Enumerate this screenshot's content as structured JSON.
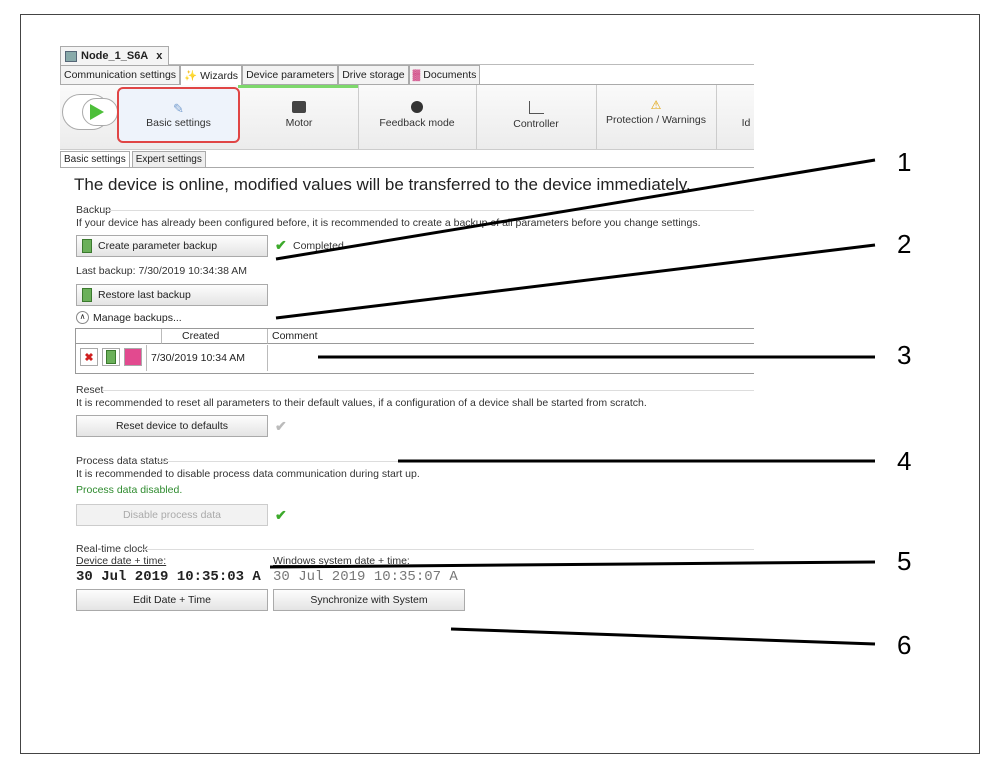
{
  "document_tab": {
    "title": "Node_1_S6A",
    "close": "x"
  },
  "section_tabs": [
    {
      "label": "Communication settings"
    },
    {
      "label": "Wizards",
      "active": true
    },
    {
      "label": "Device parameters"
    },
    {
      "label": "Drive storage"
    },
    {
      "label": "Documents"
    }
  ],
  "wizard_steps": [
    {
      "label": "Basic settings",
      "icon": "pen-icon",
      "active": true
    },
    {
      "label": "Motor",
      "icon": "motor-icon"
    },
    {
      "label": "Feedback mode",
      "icon": "feedback-icon"
    },
    {
      "label": "Controller",
      "icon": "controller-icon"
    },
    {
      "label": "Protection / Warnings",
      "icon": "warning-icon"
    },
    {
      "label": "Id"
    }
  ],
  "sub_tabs": [
    {
      "label": "Basic settings",
      "active": true
    },
    {
      "label": "Expert settings"
    }
  ],
  "headline": "The device is online, modified  values will be transferred to the device immediately.",
  "backup": {
    "title": "Backup",
    "description": "If your device has already been configured before, it is recommended to create a backup of all parameters before you change settings.",
    "create_button": "Create parameter backup",
    "status": "Completed",
    "last_backup": "Last backup:  7/30/2019 10:34:38 AM",
    "restore_button": "Restore last backup",
    "manage": "Manage backups...",
    "table": {
      "columns": [
        "Created",
        "Comment"
      ],
      "rows": [
        {
          "created": "7/30/2019 10:34 AM",
          "comment": ""
        }
      ]
    }
  },
  "reset": {
    "title": "Reset",
    "description": "It is recommended to reset all parameters to their default values, if a configuration of a device shall be started from scratch.",
    "button": "Reset device to defaults"
  },
  "process_data": {
    "title": "Process data status",
    "description": "It is recommended to disable process data communication during start up.",
    "status": "Process data disabled.",
    "button": "Disable process data"
  },
  "clock": {
    "title": "Real-time clock",
    "device_label": "Device date + time:",
    "device_value": "30 Jul 2019 10:35:03 A",
    "system_label": "Windows system date + time:",
    "system_value": "30 Jul 2019 10:35:07 A",
    "edit_button": "Edit Date + Time",
    "sync_button": "Synchronize with System"
  },
  "callouts": [
    "1",
    "2",
    "3",
    "4",
    "5",
    "6"
  ],
  "colors": {
    "accent_green": "#4dbf3a",
    "highlight_red": "#e04545"
  }
}
